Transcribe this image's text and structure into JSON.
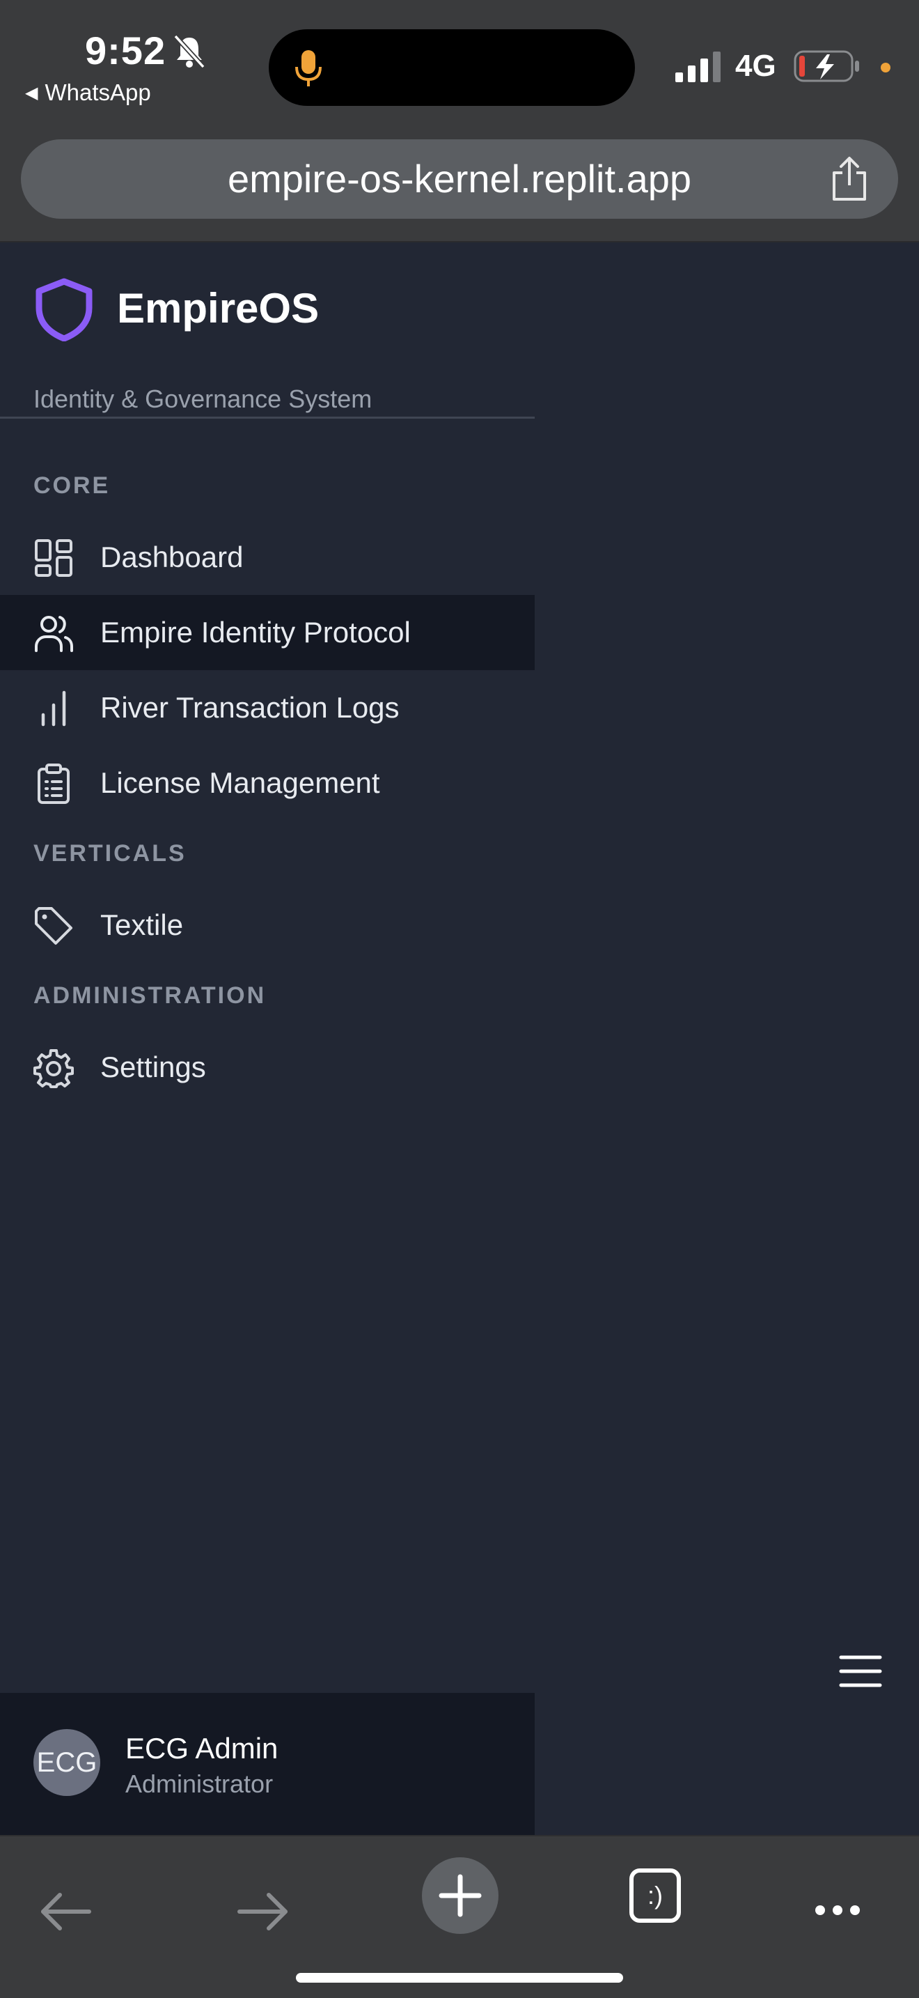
{
  "status_bar": {
    "time": "9:52",
    "back_app": "WhatsApp",
    "network": "4G"
  },
  "browser": {
    "url": "empire-os-kernel.replit.app"
  },
  "sidebar": {
    "brand_name": "EmpireOS",
    "brand_subtitle": "Identity & Governance System",
    "sections": [
      {
        "title": "CORE",
        "items": [
          {
            "label": "Dashboard",
            "icon": "dashboard-icon",
            "active": false
          },
          {
            "label": "Empire Identity Protocol",
            "icon": "users-icon",
            "active": true
          },
          {
            "label": "River Transaction Logs",
            "icon": "bar-chart-icon",
            "active": false
          },
          {
            "label": "License Management",
            "icon": "clipboard-icon",
            "active": false
          }
        ]
      },
      {
        "title": "VERTICALS",
        "items": [
          {
            "label": "Textile",
            "icon": "tag-icon",
            "active": false
          }
        ]
      },
      {
        "title": "ADMINISTRATION",
        "items": [
          {
            "label": "Settings",
            "icon": "gear-icon",
            "active": false
          }
        ]
      }
    ],
    "user": {
      "initials": "ECG",
      "name": "ECG Admin",
      "role": "Administrator"
    }
  },
  "colors": {
    "accent": "#8b5cf6",
    "sidebar_bg": "#222734",
    "active_bg": "#141823"
  },
  "toolbar": {
    "tabs_label": ":)"
  }
}
